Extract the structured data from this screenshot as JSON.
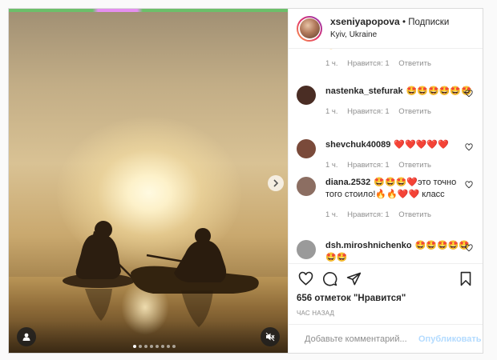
{
  "post": {
    "author": {
      "username": "xseniyapopova",
      "follow_label": "• Подписки",
      "location": "Kyiv, Ukraine",
      "icon": "profile-avatar"
    },
    "comments": [
      {
        "username": "",
        "text": "🔥😍😍😍",
        "time": "1 ч.",
        "likes_label": "Нравится: 1",
        "reply_label": "Ответить",
        "avatar_color": "#c9a48a",
        "partial": true
      },
      {
        "username": "nastenka_stefurak",
        "text": "🤩🤩🤩🤩🤩🤩",
        "time": "1 ч.",
        "likes_label": "Нравится: 1",
        "reply_label": "Ответить",
        "avatar_color": "#4a2d24"
      },
      {
        "username": "shevchuk40089",
        "text": "❤️❤️❤️❤️❤️",
        "time": "1 ч.",
        "likes_label": "Нравится: 1",
        "reply_label": "Ответить",
        "avatar_color": "#7a4a3a"
      },
      {
        "username": "diana.2532",
        "text": "🤩🤩🤩❤️это точно того стоило!🔥🔥❤️❤️ класс",
        "time": "1 ч.",
        "likes_label": "Нравится: 1",
        "reply_label": "Ответить",
        "avatar_color": "#8c6e62"
      },
      {
        "username": "dsh.miroshnichenko",
        "text": "🤩🤩🤩🤩🤩🤩🤩",
        "time": "",
        "likes_label": "",
        "reply_label": "",
        "avatar_color": "#9a9a9a"
      }
    ],
    "likes_text": "656 отметок \"Нравится\"",
    "time_ago": "час назад",
    "add_comment": {
      "placeholder": "Добавьте комментарий...",
      "publish_label": "Опубликовать"
    },
    "carousel": {
      "slide_count": 8,
      "active_index": 0
    },
    "colors": {
      "accent": "#0095f6",
      "publish_disabled": "#b3dbff",
      "muted_text": "#8e8e8e",
      "heart": "#ed4956"
    }
  }
}
